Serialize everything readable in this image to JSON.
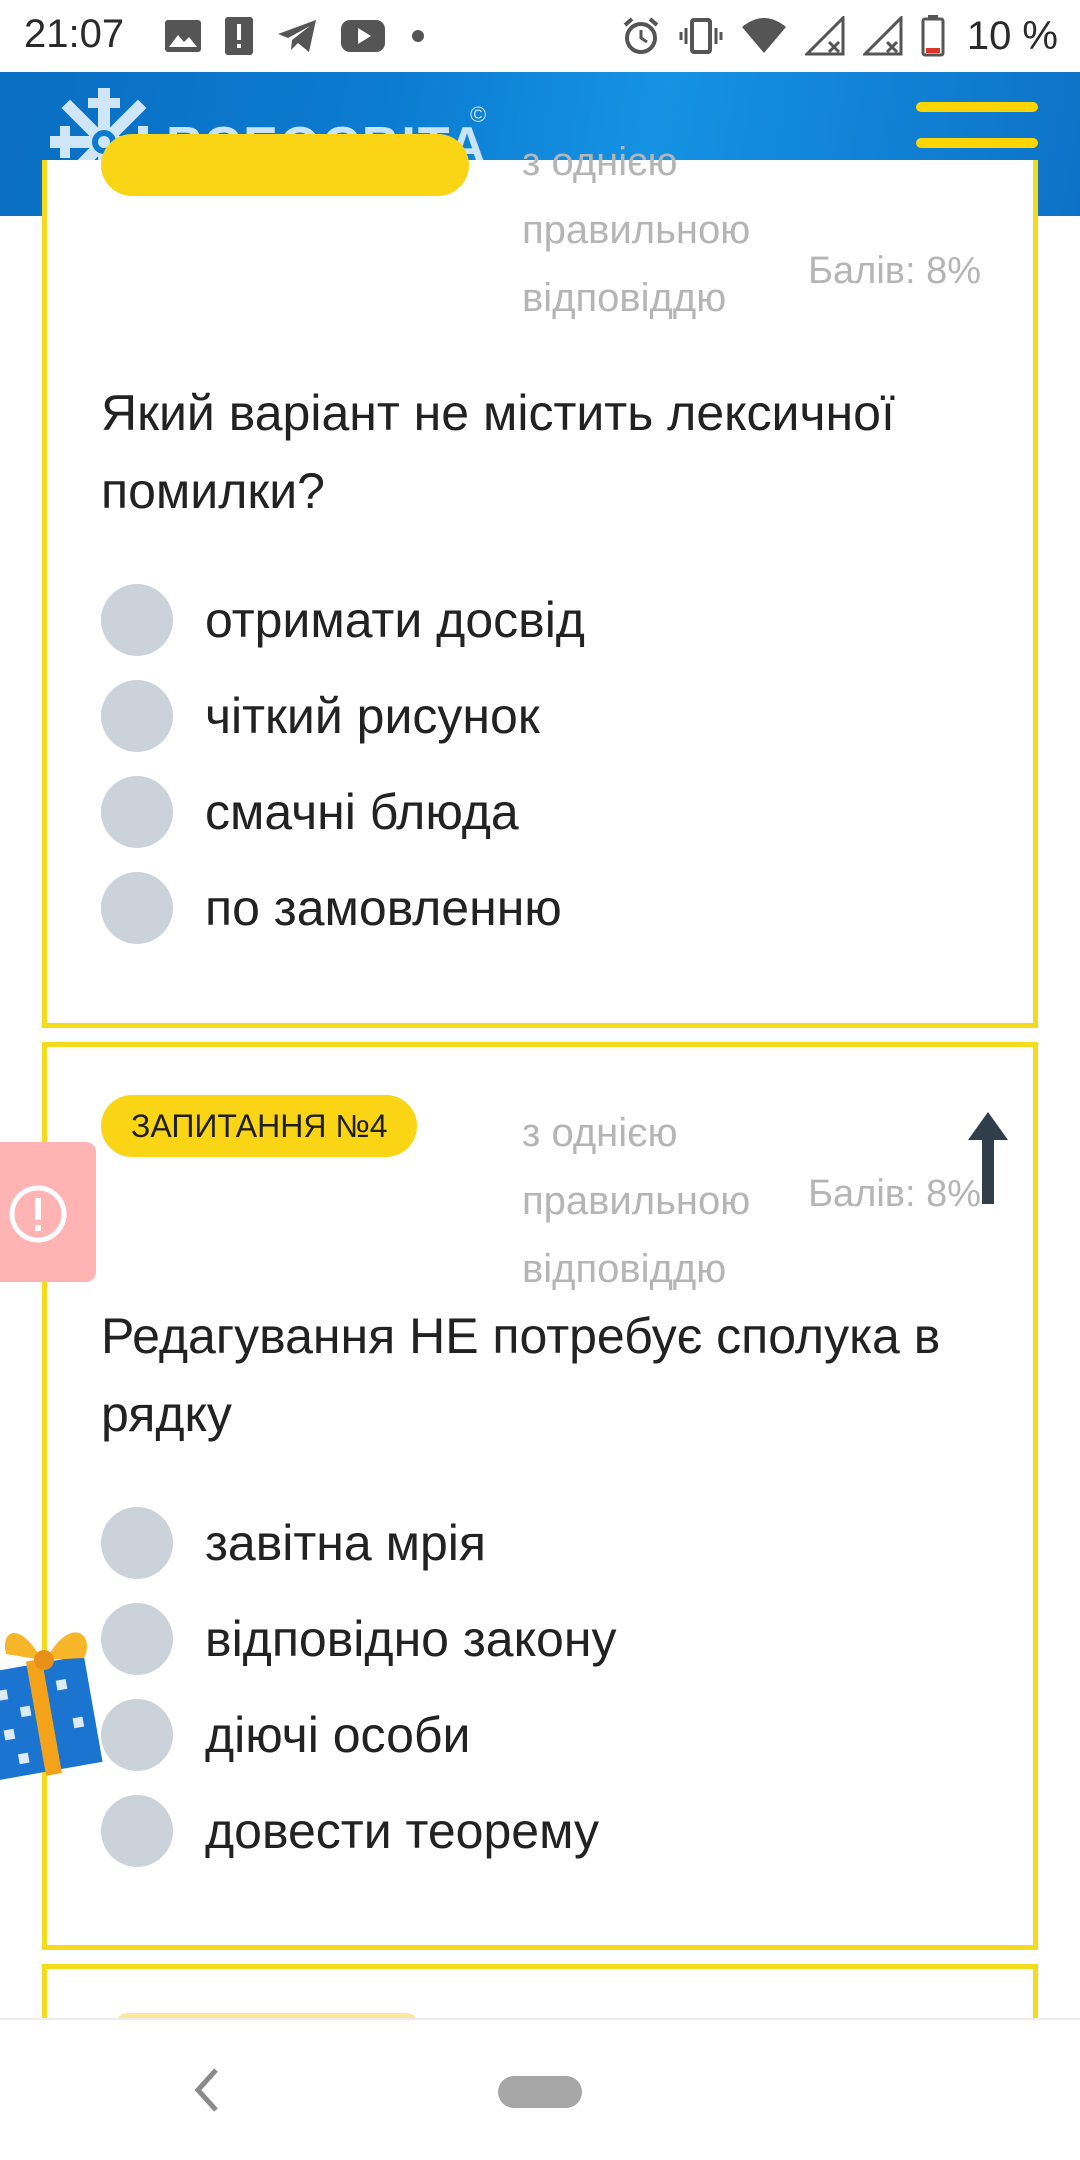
{
  "status_bar": {
    "time": "21:07",
    "battery_text": "10 %",
    "left_icons": [
      "image-icon",
      "alert-icon",
      "telegram-icon",
      "youtube-icon",
      "dot-icon"
    ],
    "right_icons": [
      "alarm-icon",
      "vibrate-icon",
      "wifi-icon",
      "signal-icon",
      "signal-icon",
      "battery-icon"
    ]
  },
  "header": {
    "logo_text": "ВСЕОСВІТА",
    "logo_copyright": "©",
    "menu_icon": "hamburger-menu-icon"
  },
  "colors": {
    "header_blue": "#0b7bd0",
    "accent_yellow": "#f9d516",
    "card_border": "#f4db1c",
    "radio_gray": "#ccd2da",
    "muted_text": "#b5b5b5"
  },
  "questions": [
    {
      "badge": "",
      "type_text": "з однією правильною відповіддю",
      "score": "Балів: 8%",
      "text": "Який варіант не містить лексичної помилки?",
      "answers": [
        "отримати досвід",
        "чіткий рисунок",
        "смачні блюда",
        "по замовленню"
      ]
    },
    {
      "badge": "ЗАПИТАННЯ №4",
      "type_text": "з однією правильною відповіддю",
      "score": "Балів: 8%",
      "text": "Редагування НЕ потребує сполука в рядку",
      "answers": [
        "завітна мрія",
        "відповідно закону",
        "діючі особи",
        "довести теорему"
      ]
    }
  ],
  "scroll_up_icon": "arrow-up-icon",
  "floating": {
    "alert_icon": "exclamation-circle-icon",
    "gift_icon": "gift-icon"
  },
  "nav_bar": {
    "back_icon": "back-chevron-icon",
    "home_icon": "home-pill-icon"
  }
}
